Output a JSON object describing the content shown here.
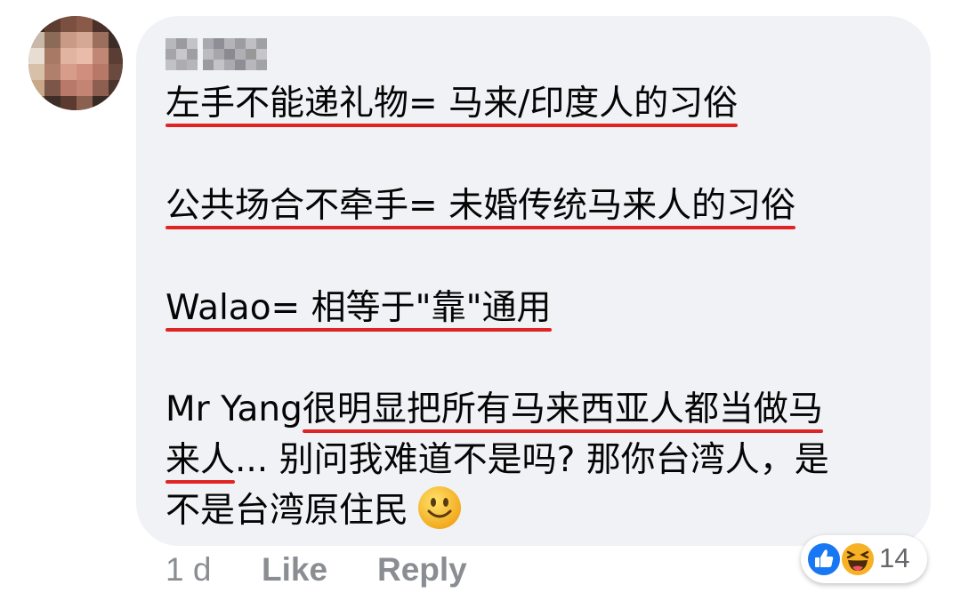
{
  "comment": {
    "lines": [
      {
        "text": "左手不能递礼物= 马来/印度人的习俗"
      },
      {
        "text": "公共场合不牵手= 未婚传统马来人的习俗"
      },
      {
        "text": "Walao= 相等于\"靠\"通用"
      },
      {
        "plain": "Mr Yang",
        "underlined": "很明显把所有马来西亚人都当做马"
      },
      {
        "underlined": "来人",
        "plain": "... 别问我难道不是吗? 那你台湾人，是"
      },
      {
        "text": "不是台湾原住民"
      }
    ],
    "emoji": "slightly-smiling-face"
  },
  "footer": {
    "time": "1 d",
    "like_label": "Like",
    "reply_label": "Reply"
  },
  "reactions": {
    "icons": [
      "like-icon",
      "haha-icon"
    ],
    "count": "14"
  },
  "colors": {
    "bubble": "#f0f2f5",
    "underline": "#e02424",
    "footer_text": "#8a8d91",
    "like_blue": "#1877f2",
    "haha_yellow": "#f7b125"
  }
}
